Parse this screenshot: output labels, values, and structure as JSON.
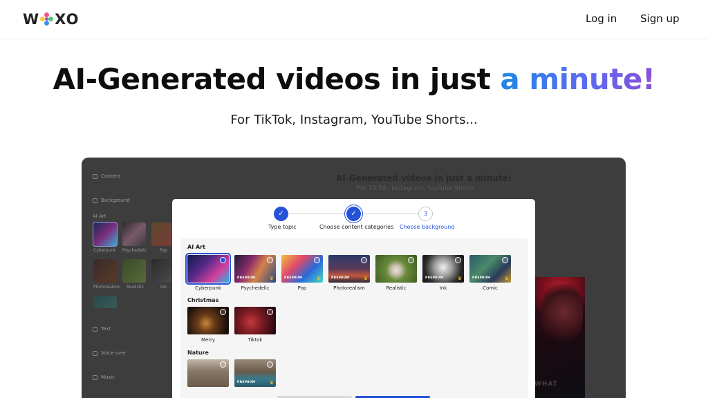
{
  "header": {
    "logo_left": "W",
    "logo_right": "XO",
    "login_label": "Log in",
    "signup_label": "Sign up"
  },
  "hero": {
    "title_main": "AI-Generated videos in just ",
    "title_accent": "a minute!",
    "subtitle": "For TikTok, Instagram, YouTube Shorts..."
  },
  "demo_background": {
    "sidebar": {
      "content_label": "Content",
      "background_label": "Background",
      "ai_art_label": "AI Art",
      "thumb_labels": [
        "Cyberpunk",
        "Psychedelic",
        "Pop",
        "Photorealism",
        "Realistic",
        "Ink"
      ],
      "text_label": "Text",
      "voice_over_label": "Voice over",
      "music_label": "Music"
    },
    "title": "AI-Generated videos in just a minute!",
    "subtitle": "For TikTok, Instagram, YouTube Shorts",
    "preview_overlay": "WHAT"
  },
  "modal": {
    "steps": [
      {
        "label": "Type topic",
        "state": "done"
      },
      {
        "label": "Choose content categories",
        "state": "done"
      },
      {
        "label": "Choose background",
        "number": "3",
        "state": "active"
      }
    ],
    "sections": [
      {
        "title": "AI Art",
        "cards": [
          {
            "label": "Cyberpunk",
            "premium": false,
            "selected": true
          },
          {
            "label": "Psychedelic",
            "badge": "PREMIUM",
            "premium": true
          },
          {
            "label": "Pop",
            "badge": "PREMIUM",
            "premium": true
          },
          {
            "label": "Photorealism",
            "badge": "PREMIUM",
            "premium": true
          },
          {
            "label": "Realistic",
            "premium": false
          },
          {
            "label": "Ink",
            "badge": "PREMIUM",
            "premium": true
          },
          {
            "label": "Comic",
            "badge": "PREMIUM",
            "premium": true
          }
        ]
      },
      {
        "title": "Christmas",
        "cards": [
          {
            "label": "Merry",
            "premium": false
          },
          {
            "label": "Tiktok",
            "premium": false
          }
        ]
      },
      {
        "title": "Nature",
        "cards": [
          {
            "label": "",
            "premium": false
          },
          {
            "label": "",
            "badge": "PREMIUM",
            "premium": true
          }
        ]
      }
    ]
  },
  "colors": {
    "accent_blue": "#2452d9",
    "gradient_start": "#1e88e5",
    "gradient_end": "#8a4fd8",
    "premium_crown": "#f5c518"
  },
  "icons": [
    "flower-logo-icon",
    "check-icon",
    "crown-icon",
    "radio-icon",
    "content-icon",
    "background-icon",
    "text-icon",
    "mic-icon",
    "music-icon"
  ]
}
